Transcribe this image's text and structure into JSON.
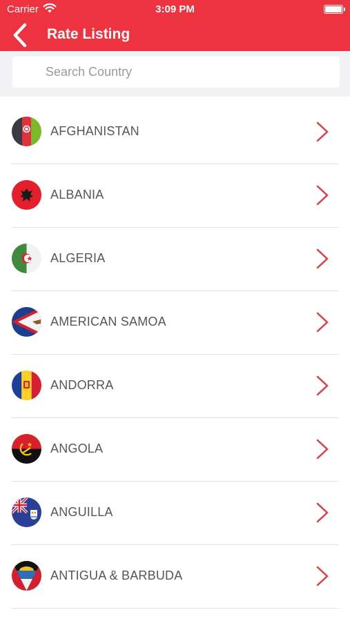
{
  "status_bar": {
    "carrier": "Carrier",
    "time": "3:09 PM"
  },
  "nav": {
    "title": "Rate Listing",
    "back_icon": "chevron-left-icon"
  },
  "search": {
    "placeholder": "Search Country",
    "value": ""
  },
  "countries": [
    {
      "name": "AFGHANISTAN",
      "flag_icon": "flag-afghanistan-icon"
    },
    {
      "name": "ALBANIA",
      "flag_icon": "flag-albania-icon"
    },
    {
      "name": "ALGERIA",
      "flag_icon": "flag-algeria-icon"
    },
    {
      "name": "AMERICAN SAMOA",
      "flag_icon": "flag-american-samoa-icon"
    },
    {
      "name": "ANDORRA",
      "flag_icon": "flag-andorra-icon"
    },
    {
      "name": "ANGOLA",
      "flag_icon": "flag-angola-icon"
    },
    {
      "name": "ANGUILLA",
      "flag_icon": "flag-anguilla-icon"
    },
    {
      "name": "ANTIGUA & BARBUDA",
      "flag_icon": "flag-antigua-barbuda-icon"
    }
  ],
  "colors": {
    "accent": "#ee3340",
    "chevron": "#e23a43",
    "text": "#555555"
  }
}
